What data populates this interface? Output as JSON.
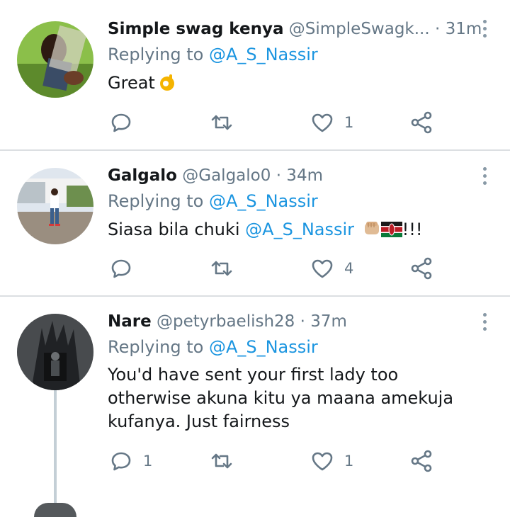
{
  "tweets": [
    {
      "name": "Simple swag kenya",
      "handle": "@SimpleSwagk...",
      "time": "· 31m",
      "replying_prefix": "Replying to ",
      "replying_to": "@A_S_Nassir",
      "text": "Great",
      "reply_count": "",
      "like_count": "1"
    },
    {
      "name": "Galgalo",
      "handle": "@Galgalo0",
      "time": "· 34m",
      "replying_prefix": "Replying to ",
      "replying_to": "@A_S_Nassir",
      "text_prefix": "Siasa bila chuki ",
      "text_mention": "@A_S_Nassir",
      "text_suffix": "!!!",
      "reply_count": "",
      "like_count": "4"
    },
    {
      "name": "Nare",
      "handle": "@petyrbaelish28",
      "time": "· 37m",
      "replying_prefix": "Replying to ",
      "replying_to": "@A_S_Nassir",
      "text": "You'd have sent your first lady too otherwise akuna kitu ya maana amekuja kufanya. Just fairness",
      "reply_count": "1",
      "like_count": "1"
    }
  ],
  "icons": {
    "reply": "reply-icon",
    "retweet": "retweet-icon",
    "like": "heart-icon",
    "share": "share-icon",
    "more": "more-vertical-icon"
  },
  "colors": {
    "mention": "#1b95e0",
    "secondary": "#657786",
    "divider": "#dcdfe2"
  }
}
